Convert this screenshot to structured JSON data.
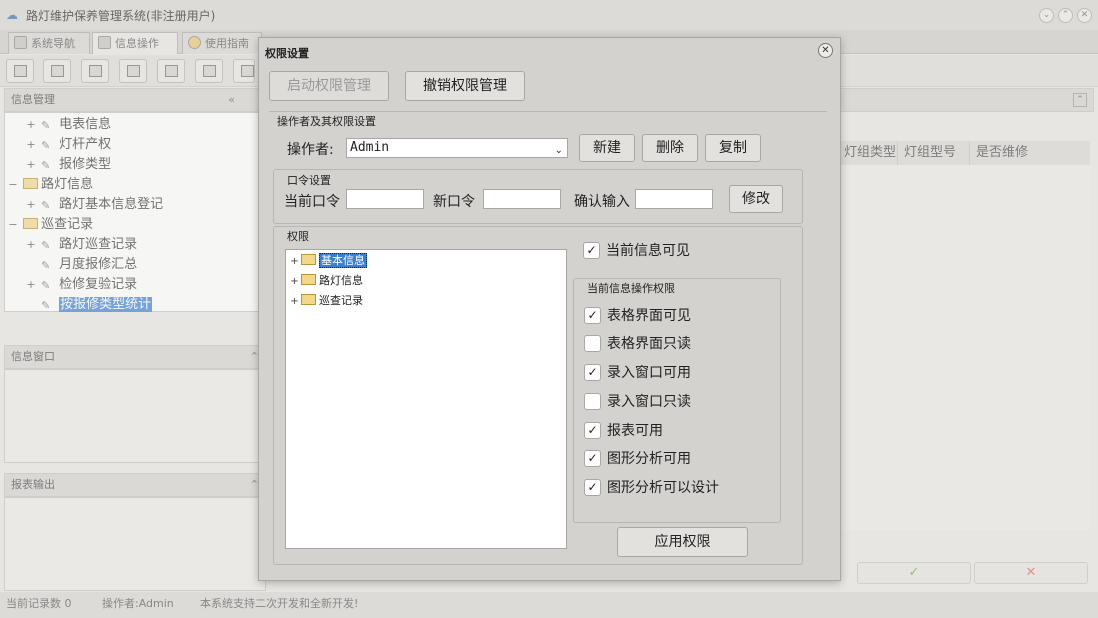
{
  "window": {
    "title": "路灯维护保养管理系统(非注册用户)",
    "tabs": [
      {
        "label": "系统导航"
      },
      {
        "label": "信息操作"
      },
      {
        "label": "使用指南"
      }
    ]
  },
  "left": {
    "info_mgmt_title": "信息管理",
    "tree": [
      {
        "label": "电表信息",
        "expander": "+"
      },
      {
        "label": "灯杆产权",
        "expander": "+"
      },
      {
        "label": "报修类型",
        "expander": "+"
      },
      {
        "label": "路灯信息",
        "expander": "−"
      },
      {
        "label": "路灯基本信息登记",
        "expander": "+"
      },
      {
        "label": "巡查记录",
        "expander": "−"
      },
      {
        "label": "路灯巡查记录",
        "expander": "+"
      },
      {
        "label": "月度报修汇总",
        "expander": ""
      },
      {
        "label": "检修复验记录",
        "expander": "+"
      },
      {
        "label": "按报修类型统计",
        "expander": ""
      }
    ],
    "info_window_title": "信息窗口",
    "report_output_title": "报表输出"
  },
  "grid": {
    "columns": [
      "灯组类型",
      "灯组型号",
      "是否维修"
    ],
    "ok_icon": "✓",
    "cancel_icon": "✕"
  },
  "status": {
    "record_count": "当前记录数 0",
    "operator": "操作者:Admin",
    "note": "本系统支持二次开发和全新开发!"
  },
  "dialog": {
    "title": "权限设置",
    "enable_btn": "启动权限管理",
    "revoke_btn": "撤销权限管理",
    "operator_group": "操作者及其权限设置",
    "operator_label": "操作者:",
    "operator_value": "Admin",
    "new_btn": "新建",
    "delete_btn": "删除",
    "copy_btn": "复制",
    "password_group": "口令设置",
    "current_pw_label": "当前口令",
    "new_pw_label": "新口令",
    "confirm_pw_label": "确认输入",
    "modify_btn": "修改",
    "perm_group": "权限",
    "perm_tree": [
      "基本信息",
      "路灯信息",
      "巡查记录"
    ],
    "current_visible": "当前信息可见",
    "ops_group": "当前信息操作权限",
    "ops": [
      {
        "label": "表格界面可见",
        "checked": true
      },
      {
        "label": "表格界面只读",
        "checked": false
      },
      {
        "label": "录入窗口可用",
        "checked": true
      },
      {
        "label": "录入窗口只读",
        "checked": false
      },
      {
        "label": "报表可用",
        "checked": true
      },
      {
        "label": "图形分析可用",
        "checked": true
      },
      {
        "label": "图形分析可以设计",
        "checked": true
      }
    ],
    "apply_btn": "应用权限"
  }
}
